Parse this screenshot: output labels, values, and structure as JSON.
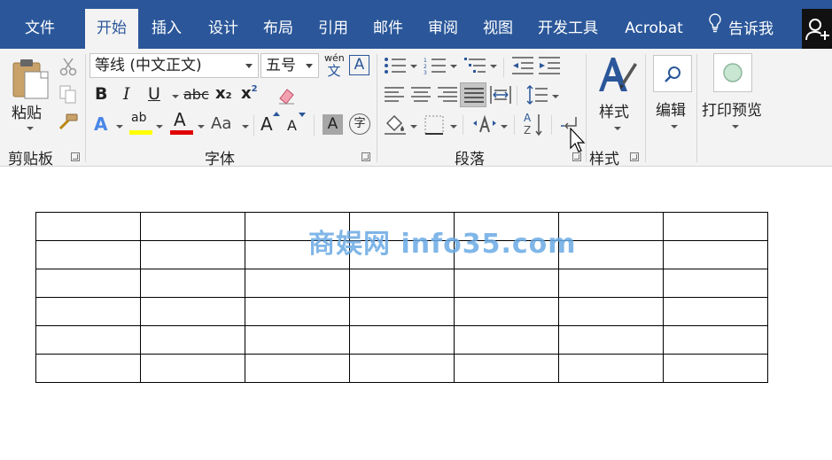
{
  "tabs": [
    {
      "label": "文件"
    },
    {
      "label": "开始"
    },
    {
      "label": "插入"
    },
    {
      "label": "设计"
    },
    {
      "label": "布局"
    },
    {
      "label": "引用"
    },
    {
      "label": "邮件"
    },
    {
      "label": "审阅"
    },
    {
      "label": "视图"
    },
    {
      "label": "开发工具"
    },
    {
      "label": "Acrobat"
    }
  ],
  "tell_me": "告诉我",
  "ribbon": {
    "clipboard": {
      "paste_label": "粘贴",
      "group_label": "剪贴板"
    },
    "font": {
      "font_name": "等线 (中文正文)",
      "font_size": "五号",
      "phonetic_top": "wén",
      "phonetic_bottom": "文",
      "border_char": "A",
      "bold": "B",
      "italic": "I",
      "underline": "U",
      "strike": "abc",
      "subscript": "x",
      "subscript_mark": "2",
      "superscript": "x",
      "superscript_mark": "2",
      "text_effect": "A",
      "highlight": "ab",
      "font_color": "A",
      "change_case": "Aa",
      "grow": "A",
      "shrink": "A",
      "shade_char": "A",
      "enclose_char": "字",
      "group_label": "字体"
    },
    "paragraph": {
      "sort_a": "A",
      "sort_z": "Z",
      "group_label": "段落"
    },
    "styles": {
      "button_label": "样式",
      "group_label": "样式"
    },
    "editing": {
      "button_label": "编辑"
    },
    "print_preview": {
      "button_label": "打印预览"
    }
  },
  "colors": {
    "brand": "#2b579a",
    "highlight": "#ffff00",
    "font_color": "#e00000",
    "watermark": "#6aaae4"
  },
  "document": {
    "table": {
      "rows": 6,
      "columns": 7
    },
    "watermark": "商娱网 info35.com"
  }
}
